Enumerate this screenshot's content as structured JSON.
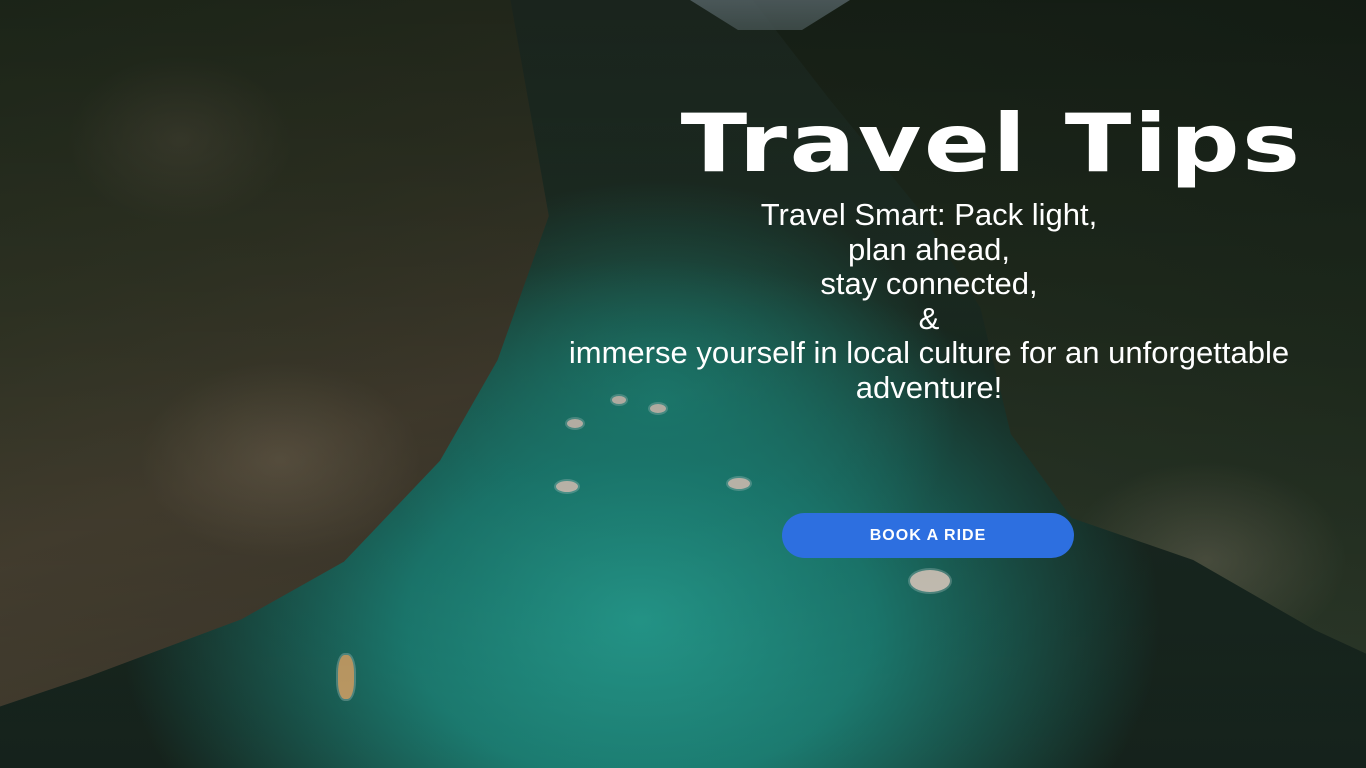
{
  "hero": {
    "title": "Travel Tips",
    "tips": {
      "line1": "Travel Smart: Pack light,",
      "line2": "plan ahead,",
      "line3": "stay connected,",
      "line4": "&",
      "line5": "immerse yourself in local culture for an unforgettable",
      "line6": "adventure!"
    },
    "cta_label": "BOOK A RIDE"
  },
  "colors": {
    "button": "#2d6fe0",
    "text": "#ffffff",
    "water": "#28aa9b"
  },
  "background_image": "aerial-canyon-river-with-boats"
}
